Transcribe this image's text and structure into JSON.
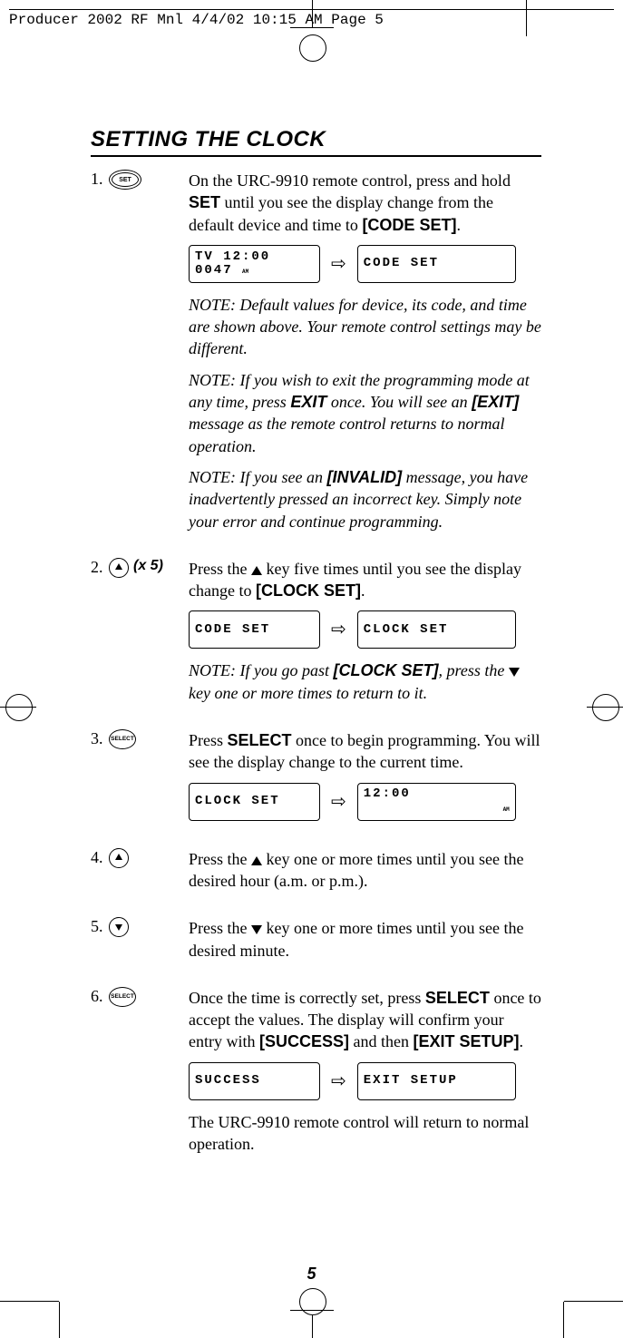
{
  "crop_header": "Producer 2002 RF Mnl  4/4/02  10:15 AM  Page 5",
  "title": "SETTING THE CLOCK",
  "page_number": "5",
  "buttons": {
    "set": "SET",
    "select": "SELECT"
  },
  "steps": [
    {
      "num": "1.",
      "icon": "set",
      "text_parts": [
        "On the URC-9910 remote control, press and hold ",
        " until you see the display change from the default device and time to ",
        "."
      ],
      "bold1": "SET",
      "bold2": "[CODE SET]",
      "lcd": {
        "left": {
          "line1": "TV        12:00",
          "line2": "0047",
          "am": "AM"
        },
        "right": {
          "line1": "CODE  SET"
        }
      },
      "notes": [
        {
          "text": "NOTE: Default values for device, its code, and time are shown above. Your remote control settings may be different."
        },
        {
          "prefix": "NOTE: If you wish to exit the programming mode at any time, press ",
          "b1": "EXIT",
          "mid": " once. You will see an ",
          "b2": "[EXIT]",
          "suffix": " message as the remote control returns to normal operation."
        },
        {
          "prefix": "NOTE: If you see an ",
          "b1": "[INVALID]",
          "suffix": " message, you have inadvertently pressed an incorrect key. Simply note your error and continue programming."
        }
      ]
    },
    {
      "num": "2.",
      "icon": "up",
      "x5": "(x 5)",
      "text_parts": [
        "Press the ",
        " key five times until you see the display change to ",
        "."
      ],
      "bold2": "[CLOCK SET]",
      "lcd": {
        "left": {
          "line1": "CODE  SET"
        },
        "right": {
          "line1": "CLOCK  SET"
        }
      },
      "notes": [
        {
          "prefix": "NOTE: If you go past ",
          "b1": "[CLOCK SET]",
          "mid": ", press the ",
          "suffix": " key one or more times to return to it.",
          "down_arrow": true
        }
      ]
    },
    {
      "num": "3.",
      "icon": "select",
      "text_parts": [
        "Press ",
        " once to begin programming. You will see the display change to the current time."
      ],
      "bold1": "SELECT",
      "lcd": {
        "left": {
          "line1": "CLOCK  SET"
        },
        "right": {
          "line1": "          12:00",
          "am": "AM"
        }
      }
    },
    {
      "num": "4.",
      "icon": "up",
      "text_parts": [
        "Press the ",
        " key one or more times until you see the desired hour (a.m. or p.m.)."
      ]
    },
    {
      "num": "5.",
      "icon": "down",
      "text_parts": [
        "Press the ",
        " key one or more times until you see the desired minute."
      ]
    },
    {
      "num": "6.",
      "icon": "select",
      "text_parts": [
        "Once the time is correctly set, press ",
        " once to accept the values. The display will confirm your entry with ",
        " and then ",
        "."
      ],
      "bold1": "SELECT",
      "bold2": "[SUCCESS]",
      "bold3": "[EXIT SETUP]",
      "lcd": {
        "left": {
          "line1": "SUCCESS"
        },
        "right": {
          "line1": "EXIT  SETUP"
        }
      },
      "trailing": "The URC-9910 remote control will return to normal operation."
    }
  ]
}
